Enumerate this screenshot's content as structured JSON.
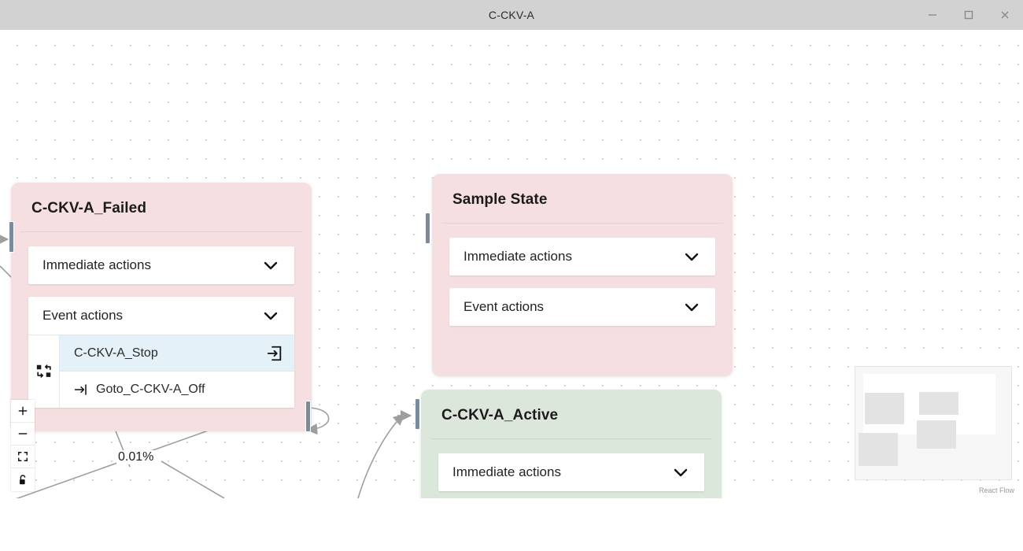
{
  "window": {
    "title": "C-CKV-A",
    "controls": [
      {
        "name": "minimize",
        "label": "Minimize"
      },
      {
        "name": "maximize",
        "label": "Maximize"
      },
      {
        "name": "close",
        "label": "Close"
      }
    ]
  },
  "canvas": {
    "background": "dots",
    "attribution": "React Flow",
    "edge_labels": [
      {
        "text": "0.01%"
      }
    ]
  },
  "nodes": [
    {
      "id": "failed",
      "title": "C-CKV-A_Failed",
      "color": "#f6dfe0",
      "sections": [
        {
          "label": "Immediate actions",
          "icon": "chevron-down-icon",
          "expanded": false,
          "rows": []
        },
        {
          "label": "Event actions",
          "icon": "chevron-down-icon",
          "expanded": true,
          "gutter_icon": "swap-icon",
          "rows": [
            {
              "text": "C-CKV-A_Stop",
              "selected": true,
              "trailing_icon": "enter-icon"
            },
            {
              "text": "Goto_C-CKV-A_Off",
              "selected": false,
              "leading_icon": "goto-icon"
            }
          ]
        }
      ]
    },
    {
      "id": "sample",
      "title": "Sample State",
      "color": "#f6dfe0",
      "sections": [
        {
          "label": "Immediate actions",
          "icon": "chevron-down-icon",
          "expanded": false,
          "rows": []
        },
        {
          "label": "Event actions",
          "icon": "chevron-down-icon",
          "expanded": false,
          "rows": []
        }
      ]
    },
    {
      "id": "active",
      "title": "C-CKV-A_Active",
      "color": "#dce7dc",
      "sections": [
        {
          "label": "Immediate actions",
          "icon": "chevron-down-icon",
          "expanded": false,
          "rows": []
        }
      ]
    }
  ],
  "controls": [
    {
      "name": "zoom-in",
      "label": "+"
    },
    {
      "name": "zoom-out",
      "label": "−"
    },
    {
      "name": "fit-view",
      "label": "Fit view"
    },
    {
      "name": "lock",
      "label": "Toggle interactivity"
    }
  ],
  "colors": {
    "pink_node": "#f6dfe0",
    "green_node": "#dce7dc",
    "selected_row": "#e4f1f8",
    "handle": "#7a8b9c",
    "edge": "#9e9e9e",
    "titlebar": "#d2d2d2"
  }
}
